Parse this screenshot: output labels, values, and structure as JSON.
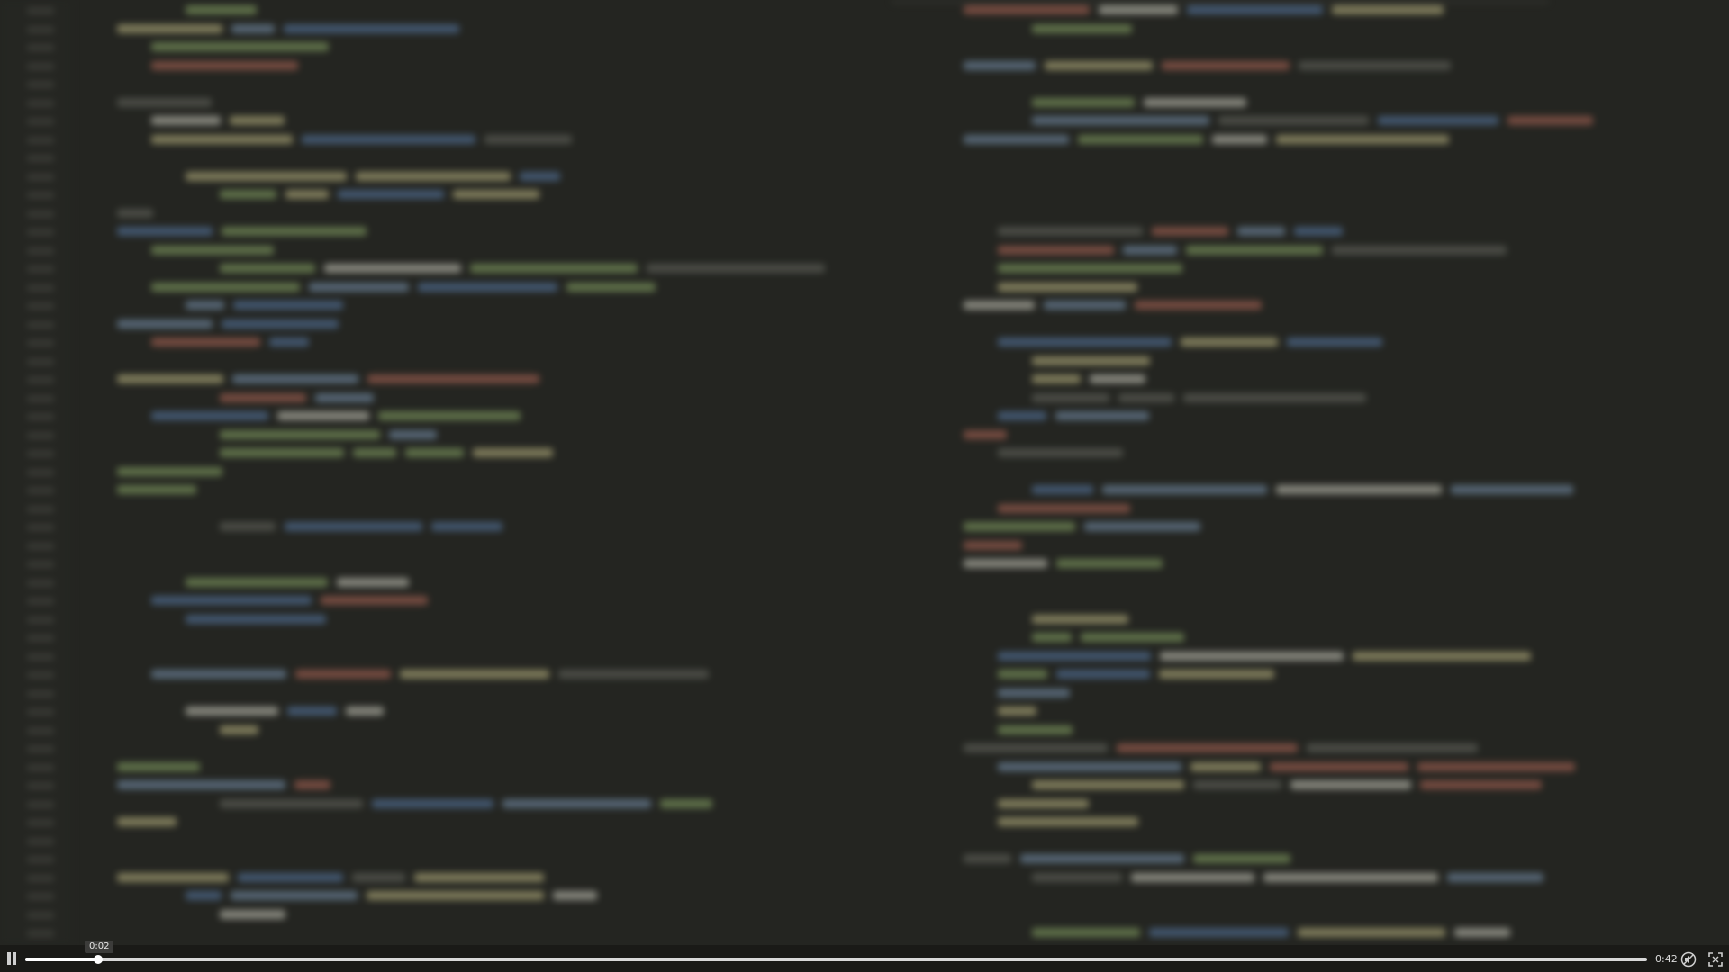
{
  "player": {
    "current_time": "0:02",
    "duration": "0:42",
    "progress_fraction": 0.045
  },
  "icons": {
    "pause": "pause-icon",
    "mute": "mute-icon",
    "fullscreen": "fullscreen-icon"
  },
  "colors": {
    "editor_bg": "#242521",
    "control_bar_bg": "#1a1a17",
    "track": "#d8d8d8",
    "fill": "#ffffff"
  }
}
